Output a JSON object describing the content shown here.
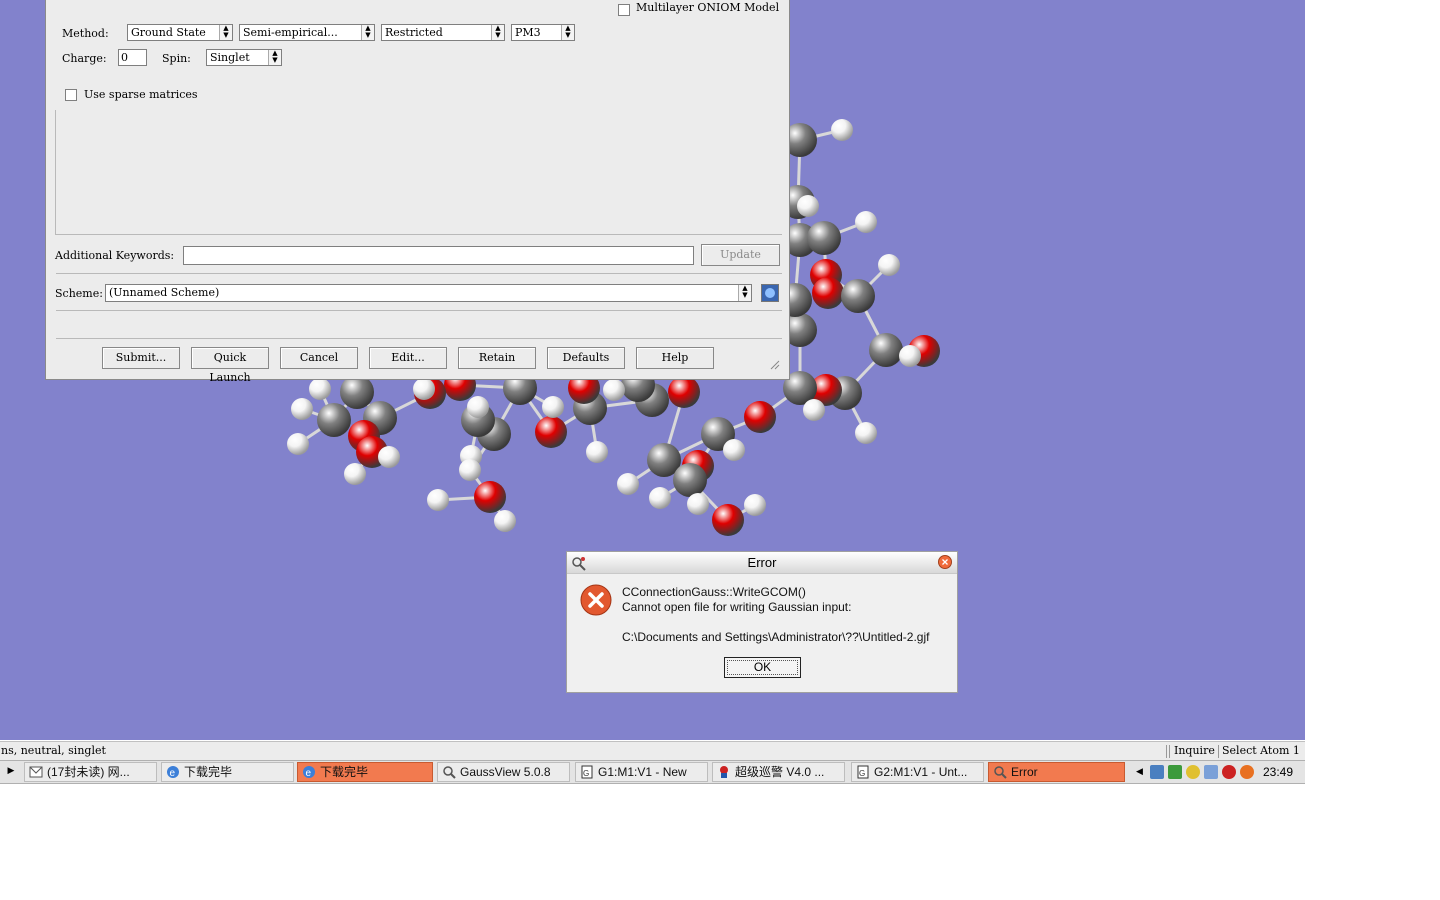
{
  "calc_dialog": {
    "onion_label": "Multilayer ONIOM Model",
    "method_label": "Method:",
    "method_state": "Ground State",
    "method_type": "Semi-empirical...",
    "method_spin": "Restricted",
    "method_basis": "PM3",
    "charge_label": "Charge:",
    "charge_value": "0",
    "spin_label": "Spin:",
    "spin_value": "Singlet",
    "sparse_label": "Use sparse matrices",
    "keywords_label": "Additional Keywords:",
    "keywords_value": "",
    "update_label": "Update",
    "scheme_label": "Scheme:",
    "scheme_value": "(Unnamed Scheme)",
    "buttons": {
      "submit": "Submit...",
      "quick_launch": "Quick Launch",
      "cancel": "Cancel",
      "edit": "Edit...",
      "retain": "Retain",
      "defaults": "Defaults",
      "help": "Help"
    }
  },
  "error_dialog": {
    "title": "Error",
    "line1": "CConnectionGauss::WriteGCOM()",
    "line2": "Cannot open file for writing Gaussian input:",
    "path": "C:\\Documents and Settings\\Administrator\\??\\Untitled-2.gjf",
    "ok_label": "OK"
  },
  "status_bar": {
    "left": "ns, neutral, singlet",
    "mode": "Inquire",
    "select": "Select Atom 1"
  },
  "taskbar": {
    "tasks": [
      "(17封未读) 网...",
      "下载完毕",
      "下载完毕",
      "GaussView 5.0.8",
      "G1:M1:V1 - New",
      "超级巡警 V4.0 ...",
      "G2:M1:V1 - Unt...",
      "Error"
    ],
    "clock": "23:49"
  },
  "colors": {
    "canvas_bg": "#8282cc",
    "oxygen": "#e00000",
    "carbon": "#808080",
    "hydrogen": "#f4f4f4",
    "active_task": "#f27a4f"
  }
}
